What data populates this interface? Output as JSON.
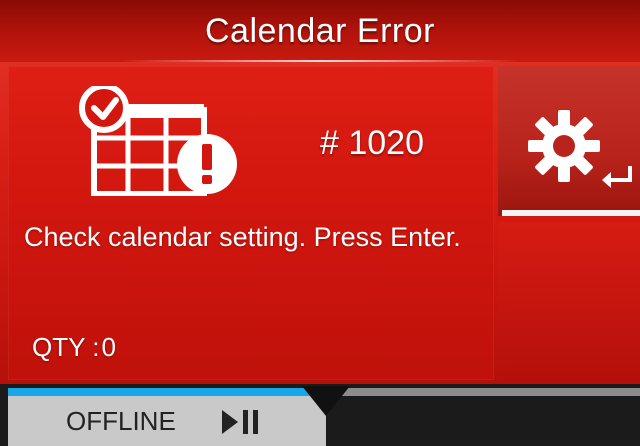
{
  "title": "Calendar Error",
  "error": {
    "code": "# 1020",
    "message": "Check calendar setting. Press Enter.",
    "qty_label": "QTY :",
    "qty_value": "0",
    "icon": "calendar-error-icon"
  },
  "settings_button": {
    "icon": "gear-icon",
    "enter_icon": "enter-icon"
  },
  "status_bar": {
    "mode_label": "OFFLINE",
    "mode_icon": "play-pause-icon",
    "progress": 0.5
  },
  "colors": {
    "background_red": "#d81f16",
    "panel_red": "#d2170f",
    "title_bar_dark": "#8a0a05",
    "progress_blue": "#18a6e6",
    "offline_button_gray": "#c9c9c9",
    "bottom_bar": "#1b1b1b",
    "text_white": "#ffffff"
  }
}
